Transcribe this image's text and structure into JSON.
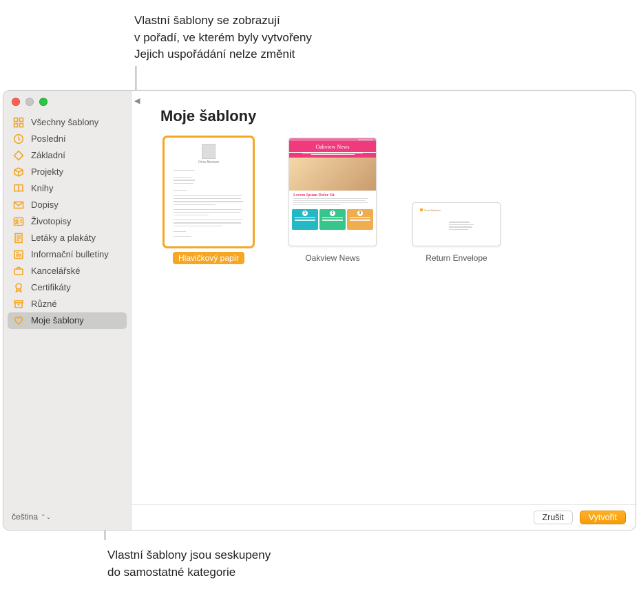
{
  "callouts": {
    "top_line1": "Vlastní šablony se zobrazují",
    "top_line2": "v pořadí, ve kterém byly vytvořeny",
    "top_line3": "Jejich uspořádání nelze změnit",
    "bottom_line1": "Vlastní šablony jsou seskupeny",
    "bottom_line2": "do samostatné kategorie"
  },
  "sidebar": {
    "items": [
      {
        "label": "Všechny šablony",
        "icon": "grid-icon"
      },
      {
        "label": "Poslední",
        "icon": "clock-icon"
      },
      {
        "label": "Základní",
        "icon": "diamond-icon"
      },
      {
        "label": "Projekty",
        "icon": "box-icon"
      },
      {
        "label": "Knihy",
        "icon": "book-icon"
      },
      {
        "label": "Dopisy",
        "icon": "envelope-icon"
      },
      {
        "label": "Životopisy",
        "icon": "person-card-icon"
      },
      {
        "label": "Letáky a plakáty",
        "icon": "poster-icon"
      },
      {
        "label": "Informační bulletiny",
        "icon": "newspaper-icon"
      },
      {
        "label": "Kancelářské",
        "icon": "briefcase-icon"
      },
      {
        "label": "Certifikáty",
        "icon": "badge-icon"
      },
      {
        "label": "Různé",
        "icon": "archive-icon"
      },
      {
        "label": "Moje šablony",
        "icon": "heart-icon"
      }
    ],
    "selected_index": 12,
    "language_label": "čeština"
  },
  "main": {
    "title": "Moje šablony",
    "templates": [
      {
        "label": "Hlavičkový papír",
        "type": "letterhead",
        "selected": true
      },
      {
        "label": "Oakview News",
        "type": "newsletter",
        "selected": false,
        "masthead": "Oakview News",
        "headline": "Lorem Ipsum Dolor Sit"
      },
      {
        "label": "Return Envelope",
        "type": "envelope",
        "selected": false
      }
    ]
  },
  "footer": {
    "cancel": "Zrušit",
    "create": "Vytvořit"
  },
  "colors": {
    "accent": "#f5a623",
    "selection_bg": "#ccccca"
  }
}
